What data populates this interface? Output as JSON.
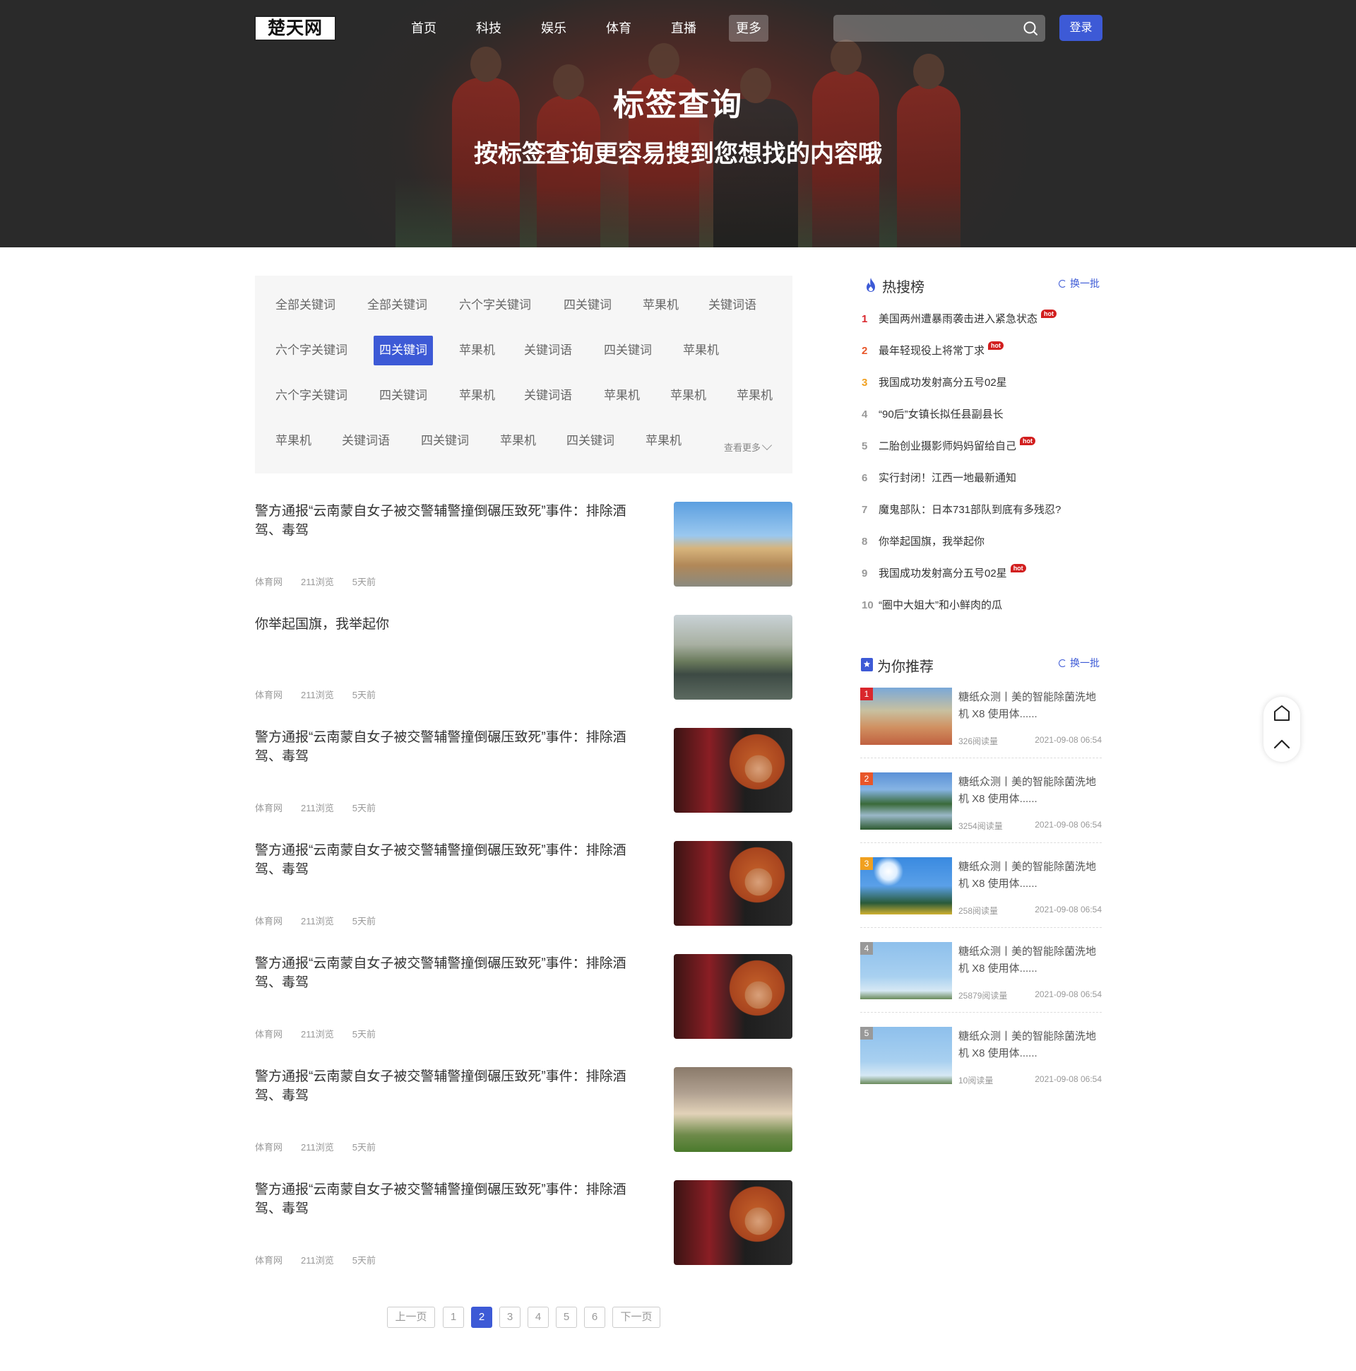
{
  "header": {
    "logo": "楚天网",
    "nav": [
      "首页",
      "科技",
      "娱乐",
      "体育",
      "直播",
      "更多"
    ],
    "nav_active_index": 5,
    "search_placeholder": "",
    "login": "登录"
  },
  "hero": {
    "title": "标签查询",
    "subtitle": "按标签查询更容易搜到您想找的内容哦"
  },
  "tags": {
    "rows": [
      [
        "全部关键词",
        "全部关键词",
        "六个字关键词",
        "四关键词",
        "苹果机",
        "关键词语"
      ],
      [
        "六个字关键词",
        "四关键词",
        "苹果机",
        "关键词语",
        "四关键词",
        "苹果机"
      ],
      [
        "六个字关键词",
        "四关键词",
        "苹果机",
        "关键词语",
        "苹果机",
        "苹果机",
        "苹果机"
      ],
      [
        "苹果机",
        "关键词语",
        "四关键词",
        "苹果机",
        "四关键词",
        "苹果机"
      ]
    ],
    "active": [
      1,
      1
    ],
    "more": "查看更多"
  },
  "articles": [
    {
      "title": "警方通报“云南蒙自女子被交警辅警撞倒碾压致死”事件：排除酒驾、毒驾",
      "source": "体育网",
      "views": "211浏览",
      "time": "5天前",
      "thumb": "building"
    },
    {
      "title": "你举起国旗，我举起你",
      "source": "体育网",
      "views": "211浏览",
      "time": "5天前",
      "thumb": "lake"
    },
    {
      "title": "警方通报“云南蒙自女子被交警辅警撞倒碾压致死”事件：排除酒驾、毒驾",
      "source": "体育网",
      "views": "211浏览",
      "time": "5天前",
      "thumb": "woman"
    },
    {
      "title": "警方通报“云南蒙自女子被交警辅警撞倒碾压致死”事件：排除酒驾、毒驾",
      "source": "体育网",
      "views": "211浏览",
      "time": "5天前",
      "thumb": "woman"
    },
    {
      "title": "警方通报“云南蒙自女子被交警辅警撞倒碾压致死”事件：排除酒驾、毒驾",
      "source": "体育网",
      "views": "211浏览",
      "time": "5天前",
      "thumb": "woman"
    },
    {
      "title": "警方通报“云南蒙自女子被交警辅警撞倒碾压致死”事件：排除酒驾、毒驾",
      "source": "体育网",
      "views": "211浏览",
      "time": "5天前",
      "thumb": "flowers"
    },
    {
      "title": "警方通报“云南蒙自女子被交警辅警撞倒碾压致死”事件：排除酒驾、毒驾",
      "source": "体育网",
      "views": "211浏览",
      "time": "5天前",
      "thumb": "woman"
    }
  ],
  "pagination": {
    "prev": "上一页",
    "pages": [
      "1",
      "2",
      "3",
      "4",
      "5",
      "6"
    ],
    "current": "2",
    "next": "下一页"
  },
  "hot_search": {
    "title": "热搜榜",
    "refresh": "换一批",
    "items": [
      {
        "rank": "1",
        "text": "美国两州遭暴雨袭击进入紧急状态",
        "hot": true
      },
      {
        "rank": "2",
        "text": "最年轻现役上将常丁求",
        "hot": true
      },
      {
        "rank": "3",
        "text": "我国成功发射高分五号02星",
        "hot": false
      },
      {
        "rank": "4",
        "text": "“90后”女镇长拟任县副县长",
        "hot": false
      },
      {
        "rank": "5",
        "text": "二胎创业摄影师妈妈留给自己",
        "hot": true
      },
      {
        "rank": "6",
        "text": "实行封闭！江西一地最新通知",
        "hot": false
      },
      {
        "rank": "7",
        "text": "魔鬼部队：日本731部队到底有多残忍?",
        "hot": false
      },
      {
        "rank": "8",
        "text": "你举起国旗，我举起你",
        "hot": false
      },
      {
        "rank": "9",
        "text": "我国成功发射高分五号02星",
        "hot": true
      },
      {
        "rank": "10",
        "text": "“圈中大姐大”和小鲜肉的瓜",
        "hot": false
      }
    ],
    "hot_label": "hot",
    "rank_colors": {
      "1": "#d9262c",
      "2": "#e8562a",
      "3": "#f0a020",
      "default": "#999999"
    }
  },
  "recommend": {
    "title": "为你推荐",
    "refresh": "换一批",
    "items": [
      {
        "num": "1",
        "title": "糖纸众测丨美的智能除菌洗地机 X8 使用体......",
        "views": "326阅读量",
        "date": "2021-09-08 06:54",
        "thumb": "kids"
      },
      {
        "num": "2",
        "title": "糖纸众测丨美的智能除菌洗地机 X8 使用体......",
        "views": "3254阅读量",
        "date": "2021-09-08 06:54",
        "thumb": "river"
      },
      {
        "num": "3",
        "title": "糖纸众测丨美的智能除菌洗地机 X8 使用体......",
        "views": "258阅读量",
        "date": "2021-09-08 06:54",
        "thumb": "sun"
      },
      {
        "num": "4",
        "title": "糖纸众测丨美的智能除菌洗地机 X8 使用体......",
        "views": "25879阅读量",
        "date": "2021-09-08 06:54",
        "thumb": "sky"
      },
      {
        "num": "5",
        "title": "糖纸众测丨美的智能除菌洗地机 X8 使用体......",
        "views": "10阅读量",
        "date": "2021-09-08 06:54",
        "thumb": "sky"
      }
    ],
    "num_colors": [
      "#d9262c",
      "#e8562a",
      "#f0a020",
      "#999999",
      "#999999"
    ]
  },
  "colors": {
    "accent": "#3d5ad6",
    "hot_badge": "#d21f1f"
  },
  "float_tools": [
    "home-icon",
    "back-to-top-icon"
  ]
}
